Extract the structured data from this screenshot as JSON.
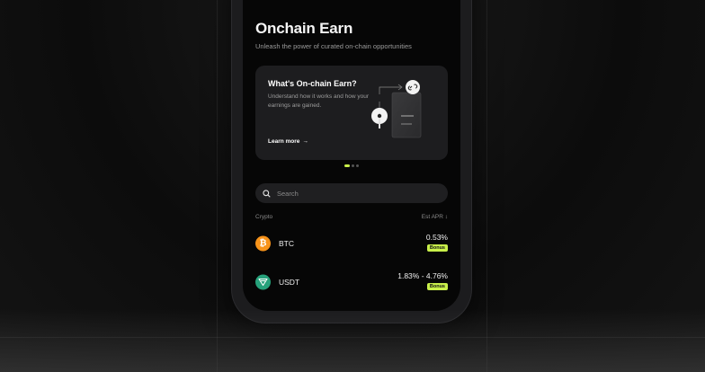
{
  "header": {
    "title": "Onchain Earn",
    "subtitle": "Unleash the power of curated on-chain opportunities"
  },
  "promo": {
    "title": "What's On-chain Earn?",
    "description": "Understand how it works and how your earnings are gained.",
    "link_label": "Learn more",
    "link_arrow": "→"
  },
  "carousel": {
    "count": 3,
    "active_index": 0
  },
  "search": {
    "placeholder": "Search"
  },
  "table": {
    "col_crypto": "Crypto",
    "col_apr": "Est APR ↕"
  },
  "rows": [
    {
      "symbol": "BTC",
      "apr": "0.53%",
      "badge": "Bonus",
      "icon": "bitcoin-icon",
      "color": "#f7931a"
    },
    {
      "symbol": "USDT",
      "apr": "1.83% - 4.76%",
      "badge": "Bonus",
      "icon": "tether-icon",
      "color": "#26a17b"
    }
  ],
  "colors": {
    "accent": "#c9f04a",
    "background": "#060606",
    "card": "#1d1d1f"
  }
}
